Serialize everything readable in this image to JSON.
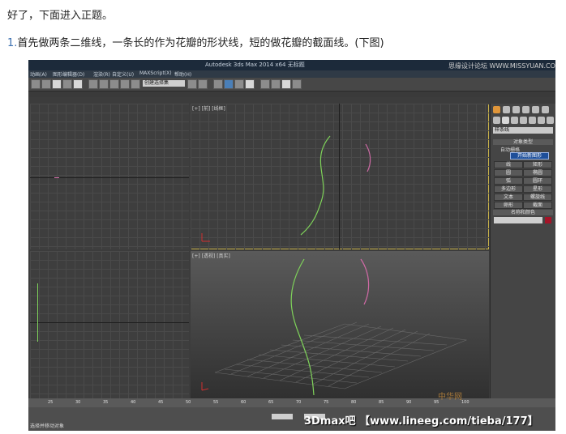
{
  "article": {
    "line1": "好了，下面进入正题。",
    "line2_num": "1.",
    "line2_text": "首先做两条二维线，一条长的作为花瓣的形状线，短的做花瓣的截面线。(下图)"
  },
  "app": {
    "title": "Autodesk 3ds Max  2014 x64    无标题",
    "watermark_top": "思缘设计论坛  WWW.MISSYUAN.COM",
    "menus": [
      "动画(A)",
      "图形编辑器(D)",
      "渲染(R)",
      "自定义(U)",
      "MAXScript(X)",
      "帮助(H)"
    ],
    "selection_dropdown": "创建选择集"
  },
  "viewports": {
    "top_left_label": "",
    "front_label": "[+] [前] [线框]",
    "persp_label": "[+] [透视] [真实]"
  },
  "command_panel": {
    "category_dropdown": "样条线",
    "rollout_object_type": "对象类型",
    "autogrid": "自动栅格",
    "start_new_shape": "开始新图形",
    "buttons": [
      "线",
      "矩形",
      "圆",
      "椭圆",
      "弧",
      "圆环",
      "多边形",
      "星形",
      "文本",
      "螺旋线",
      "卵形",
      "截面"
    ],
    "rollout_name_color": "名称和颜色",
    "object_color": "#a31428"
  },
  "timeline": {
    "ticks": [
      "25",
      "30",
      "35",
      "40",
      "45",
      "50",
      "55",
      "60",
      "65",
      "70",
      "75",
      "80",
      "85",
      "90",
      "95",
      "100"
    ]
  },
  "status": {
    "prompt": "选择并移动对象"
  },
  "watermarks": {
    "bottom": "3Dmax吧 【www.lineeg.com/tieba/177】",
    "logo": "中华网"
  },
  "colors": {
    "long_curve": "#7fd35a",
    "short_curve": "#d06aa6",
    "active_border": "#c9b34a"
  }
}
